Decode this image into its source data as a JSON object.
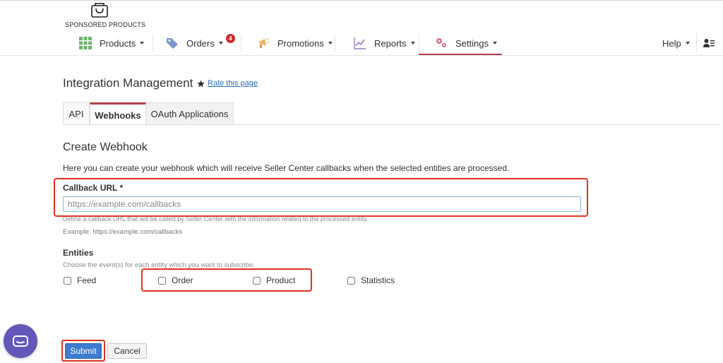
{
  "brand": {
    "logo_text": "SPONSORED PRODUCTS"
  },
  "nav": {
    "items": [
      {
        "label": "Products",
        "icon": "grid-icon"
      },
      {
        "label": "Orders",
        "icon": "tag-icon",
        "badge": "4"
      },
      {
        "label": "Promotions",
        "icon": "megaphone-icon"
      },
      {
        "label": "Reports",
        "icon": "chart-icon"
      },
      {
        "label": "Settings",
        "icon": "gear-icon"
      }
    ],
    "help_label": "Help",
    "active": "Settings"
  },
  "page": {
    "title": "Integration Management",
    "rate_link": "Rate this page"
  },
  "tabs": [
    {
      "label": "API"
    },
    {
      "label": "Webhooks"
    },
    {
      "label": "OAuth Applications"
    }
  ],
  "form": {
    "section_title": "Create Webhook",
    "description": "Here you can create your webhook which will receive Seller Center callbacks when the selected entities are processed.",
    "callback": {
      "label": "Callback URL *",
      "placeholder": "https://example.com/callbacks",
      "value": "",
      "help": "Define a callback URL that will be called by Seller Center with the information related to the processed entity.",
      "example": "Example: https://example.com/callbacks"
    },
    "entities": {
      "label": "Entities",
      "help": "Choose the event(s) for each entity which you want to subscribe.",
      "options": [
        {
          "label": "Feed",
          "checked": false
        },
        {
          "label": "Order",
          "checked": false
        },
        {
          "label": "Product",
          "checked": false
        },
        {
          "label": "Statistics",
          "checked": false
        }
      ]
    },
    "submit_label": "Submit",
    "cancel_label": "Cancel"
  },
  "colors": {
    "accent": "#b3424a",
    "highlight": "#e0331f",
    "primary_button": "#3d7ccf",
    "chat_bubble": "#6357b8"
  }
}
